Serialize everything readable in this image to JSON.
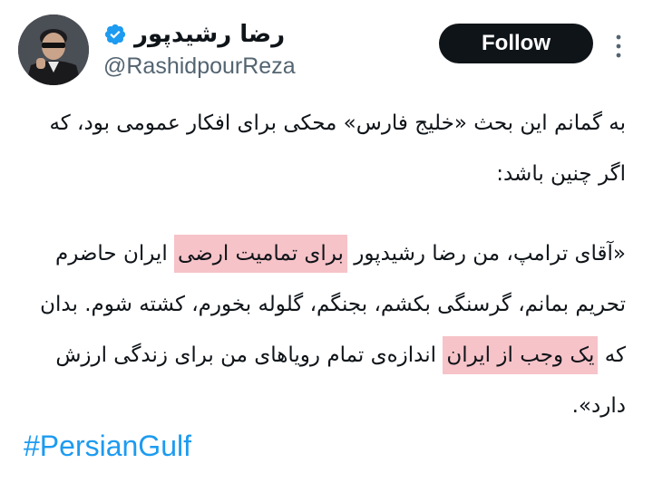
{
  "author": {
    "display_name": "رضا رشیدپور",
    "handle": "@RashidpourReza",
    "verified_icon": "verified-badge-icon"
  },
  "actions": {
    "follow_label": "Follow",
    "more_icon": "more-vertical-icon"
  },
  "colors": {
    "follow_bg": "#0f1419",
    "verified": "#1d9bf0",
    "hashtag": "#1d9bf0",
    "highlight": "#f6c3c8"
  },
  "tweet": {
    "para1": "به گمانم این بحث «خلیج فارس» محکی برای افکار عمومی بود، که اگر چنین باشد:",
    "para2_a": "«آقای ترامپ، من رضا رشیدپور ",
    "para2_hl1": "برای تمامیت ارضی",
    "para2_b": " ایران حاضرم تحریم بمانم، گرسنگی بکشم، بجنگم، گلوله بخورم، کشته شوم. بدان که ",
    "para2_hl2": "یک وجب از ایران",
    "para2_c": " اندازه‌ی تمام رویاهای من برای زندگی ارزش دارد».",
    "hashtag": "#PersianGulf"
  }
}
